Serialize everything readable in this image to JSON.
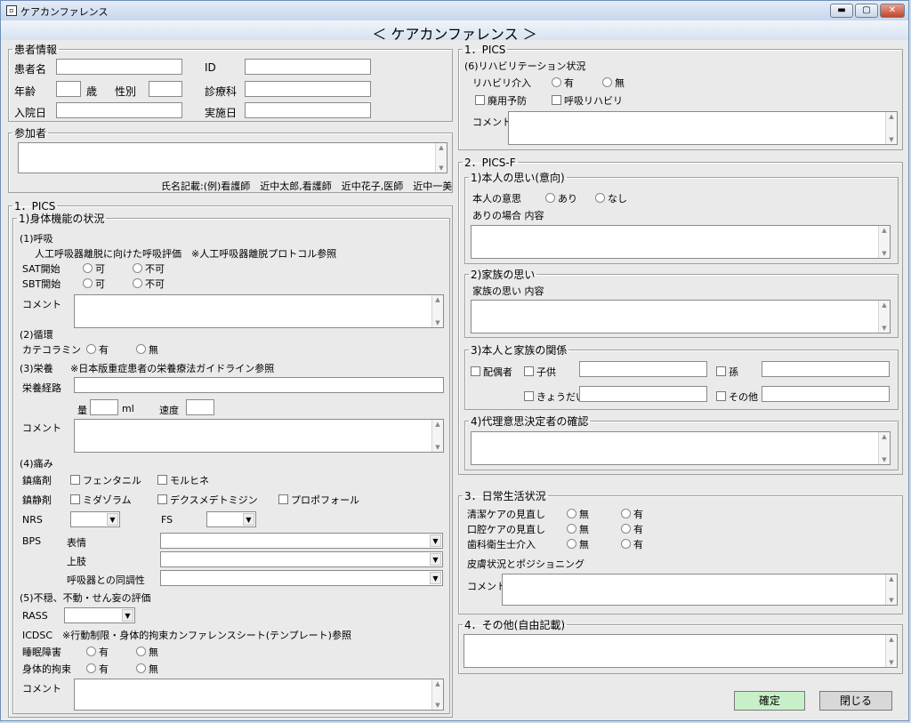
{
  "window": {
    "title": "ケアカンファレンス",
    "header": "＜ ケアカンファレンス ＞",
    "min": "▬",
    "max": "▢",
    "close": "✕"
  },
  "patient": {
    "legend": "患者情報",
    "name_label": "患者名",
    "id_label": "ID",
    "age_label": "年齢",
    "age_unit": "歳",
    "sex_label": "性別",
    "dept_label": "診療科",
    "admit_label": "入院日",
    "exec_label": "実施日"
  },
  "participants": {
    "legend": "参加者",
    "hint": "氏名記載:(例)看護師　近中太郎,看護師　近中花子,医師　近中一美"
  },
  "pics_left": {
    "legend": "1．PICS",
    "physical": {
      "legend": "1)身体機能の状況",
      "resp_title": "(1)呼吸",
      "resp_desc": "人工呼吸器離脱に向けた呼吸評価　※人工呼吸器離脱プロトコル参照",
      "sat": "SAT開始",
      "sbt": "SBT開始",
      "ok": "可",
      "ng": "不可",
      "comment": "コメント",
      "circ_title": "(2)循環",
      "catechol": "カテコラミン",
      "yes": "有",
      "no": "無",
      "nutr_title": "(3)栄養",
      "nutr_note": "※日本版重症患者の栄養療法ガイドライン参照",
      "route": "栄養経路",
      "amount": "量",
      "ml": "ml",
      "speed": "速度",
      "pain_title": "(4)痛み",
      "analgesic": "鎮痛剤",
      "fentanyl": "フェンタニル",
      "morphine": "モルヒネ",
      "sedative": "鎮静剤",
      "midazolam": "ミダゾラム",
      "dexmed": "デクスメデトミジン",
      "propofol": "プロポフォール",
      "nrs": "NRS",
      "fs": "FS",
      "bps": "BPS",
      "face": "表情",
      "upper": "上肢",
      "vent_sync": "呼吸器との同調性",
      "delirium_title": "(5)不穏、不動・せん妄の評価",
      "rass": "RASS",
      "icdsc": "ICDSC　※行動制限・身体的拘束カンファレンスシート(テンプレート)参照",
      "sleep": "睡眠障害",
      "restraint": "身体的拘束"
    }
  },
  "pics_right": {
    "legend": "1．PICS",
    "rehab_title": "(6)リハビリテーション状況",
    "rehab_int": "リハビリ介入",
    "yes": "有",
    "no": "無",
    "disuse": "廃用予防",
    "resp_rehab": "呼吸リハビリ",
    "comment": "コメント"
  },
  "pics_f": {
    "legend": "2．PICS-F",
    "self": {
      "legend": "1)本人の思い(意向)",
      "will": "本人の意思",
      "ari": "あり",
      "nashi": "なし",
      "ari_content": "ありの場合 内容"
    },
    "family": {
      "legend": "2)家族の思い",
      "content": "家族の思い 内容"
    },
    "relation": {
      "legend": "3)本人と家族の関係",
      "spouse": "配偶者",
      "child": "子供",
      "grandchild": "孫",
      "sibling": "きょうだい",
      "other": "その他"
    },
    "proxy": {
      "legend": "4)代理意思決定者の確認"
    }
  },
  "daily": {
    "legend": "3．日常生活状況",
    "clean": "清潔ケアの見直し",
    "oral": "口腔ケアの見直し",
    "dental": "歯科衛生士介入",
    "no": "無",
    "yes": "有",
    "skin": "皮膚状況とポジショニング",
    "comment": "コメント"
  },
  "other": {
    "legend": "4．その他(自由記載)"
  },
  "buttons": {
    "confirm": "確定",
    "close": "閉じる"
  }
}
